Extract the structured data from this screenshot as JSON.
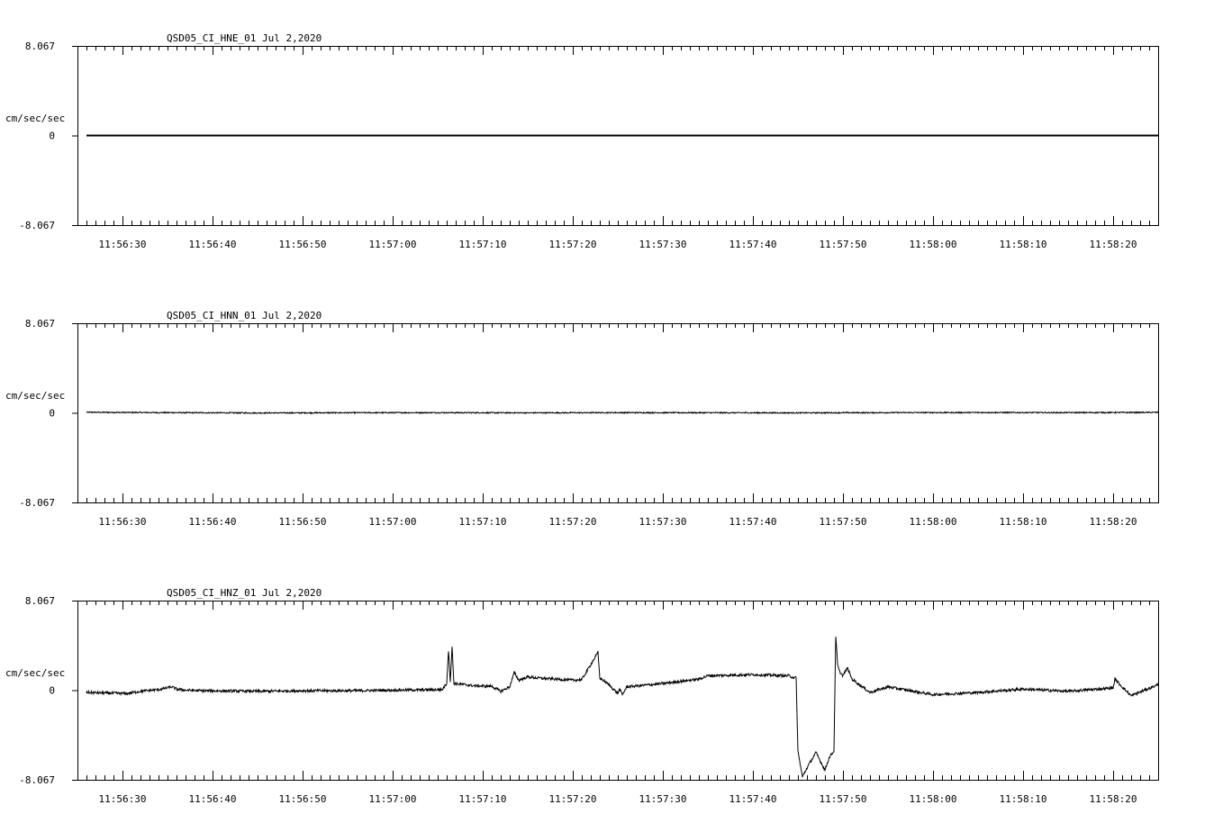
{
  "chart_data": [
    {
      "type": "line",
      "title": "QSD05_CI_HNE_01  Jul 2,2020",
      "ylabel": "cm/sec/sec",
      "ylim": [
        -8.067,
        8.067
      ],
      "y_tick_labels": [
        "8.067",
        "0",
        "-8.067"
      ],
      "x_tick_labels": [
        "11:56:30",
        "11:56:40",
        "11:56:50",
        "11:57:00",
        "11:57:10",
        "11:57:20",
        "11:57:30",
        "11:57:40",
        "11:57:50",
        "11:58:00",
        "11:58:10",
        "11:58:20"
      ],
      "x_unit": "seconds after 11:56:25",
      "xlim": [
        0,
        120
      ],
      "series": [
        {
          "x": [
            1,
            120
          ],
          "y": [
            0,
            0
          ]
        }
      ]
    },
    {
      "type": "line",
      "title": "QSD05_CI_HNN_01  Jul 2,2020",
      "ylabel": "cm/sec/sec",
      "ylim": [
        -8.067,
        8.067
      ],
      "y_tick_labels": [
        "8.067",
        "0",
        "-8.067"
      ],
      "x_tick_labels": [
        "11:56:30",
        "11:56:40",
        "11:56:50",
        "11:57:00",
        "11:57:10",
        "11:57:20",
        "11:57:30",
        "11:57:40",
        "11:57:50",
        "11:58:00",
        "11:58:10",
        "11:58:20"
      ],
      "xlim": [
        0,
        120
      ],
      "series": [
        {
          "x": [
            1,
            10,
            20,
            30,
            40,
            50,
            60,
            70,
            80,
            90,
            100,
            110,
            120
          ],
          "y": [
            0.05,
            0.02,
            -0.01,
            0.01,
            0.02,
            0.0,
            0.02,
            0.01,
            0.0,
            0.02,
            0.03,
            0.02,
            0.04
          ]
        }
      ]
    },
    {
      "type": "line",
      "title": "QSD05_CI_HNZ_01  Jul 2,2020",
      "ylabel": "cm/sec/sec",
      "ylim": [
        -8.067,
        8.067
      ],
      "y_tick_labels": [
        "8.067",
        "0",
        "-8.067"
      ],
      "x_tick_labels": [
        "11:56:30",
        "11:56:40",
        "11:56:50",
        "11:57:00",
        "11:57:10",
        "11:57:20",
        "11:57:30",
        "11:57:40",
        "11:57:50",
        "11:58:00",
        "11:58:10",
        "11:58:20"
      ],
      "xlim": [
        0,
        120
      ],
      "series": [
        {
          "x": [
            1,
            3,
            5.5,
            7,
            9,
            10.5,
            11,
            12,
            14,
            20,
            25,
            30,
            35,
            40.5,
            41,
            41.2,
            41.4,
            41.6,
            41.8,
            43,
            44,
            46,
            47,
            48,
            48.5,
            49,
            50,
            51,
            55,
            56,
            57.8,
            58,
            58.2,
            59,
            60,
            60.2,
            60.5,
            61,
            65,
            69,
            70,
            75,
            79,
            79.3,
            79.8,
            80,
            80.5,
            80.7,
            81,
            82,
            83,
            83.5,
            84,
            84.2,
            84.4,
            84.6,
            85,
            85.5,
            86,
            88,
            90,
            95,
            100,
            105,
            110,
            115,
            115.2,
            116,
            117,
            120
          ],
          "y": [
            -0.2,
            -0.25,
            -0.3,
            -0.1,
            0.05,
            0.3,
            0.1,
            0.0,
            -0.05,
            -0.1,
            -0.05,
            -0.05,
            0.0,
            0.05,
            0.6,
            3.6,
            0.8,
            3.9,
            0.6,
            0.5,
            0.4,
            0.35,
            -0.1,
            0.3,
            1.6,
            0.9,
            1.2,
            1.1,
            0.9,
            0.95,
            3.4,
            1.1,
            1.0,
            0.5,
            -0.3,
            0.1,
            -0.4,
            0.3,
            0.6,
            1.0,
            1.3,
            1.4,
            1.3,
            1.2,
            1.1,
            -5.5,
            -7.8,
            -7.5,
            -7.0,
            -5.6,
            -7.2,
            -6.0,
            -5.5,
            4.9,
            2.3,
            1.7,
            1.3,
            2.0,
            1.0,
            -0.2,
            0.3,
            -0.4,
            -0.2,
            0.1,
            -0.1,
            0.2,
            1.0,
            0.3,
            -0.5,
            0.5
          ]
        }
      ]
    }
  ]
}
